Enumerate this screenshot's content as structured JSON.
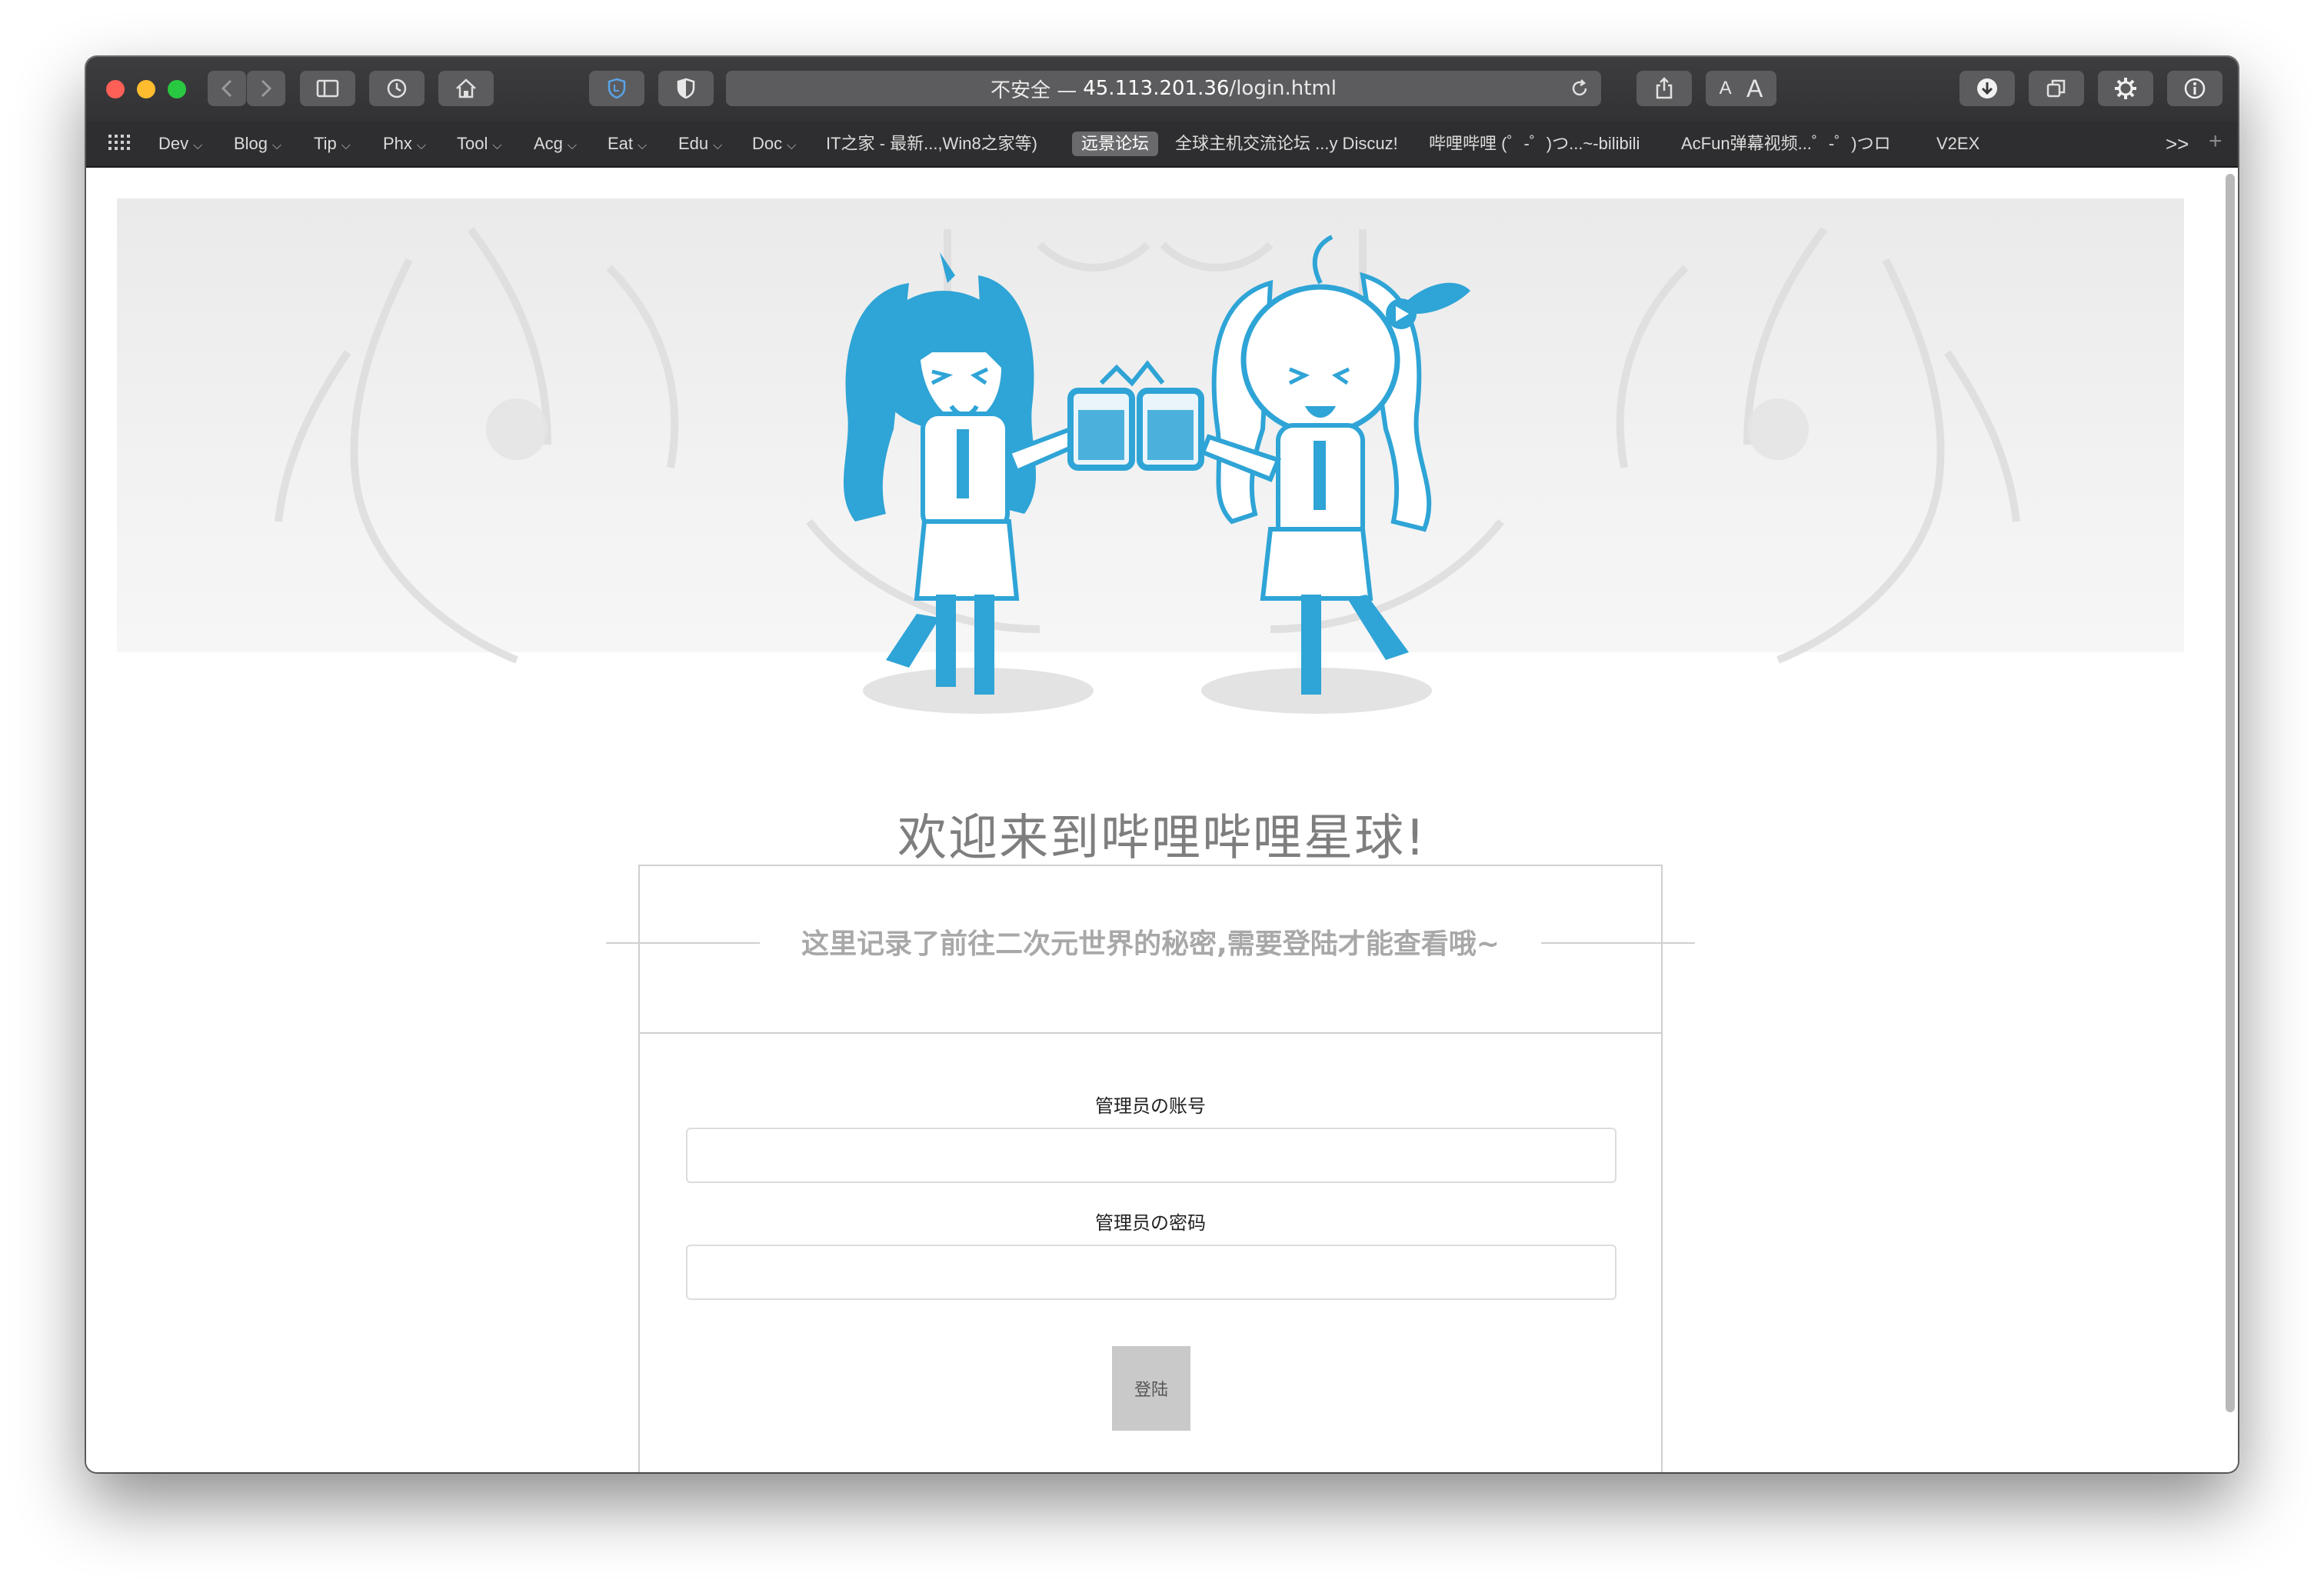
{
  "browser": {
    "address": {
      "security_label": "不安全 —",
      "host": "45.113.201.36",
      "path": "/login.html"
    },
    "toolbar_icons": [
      "back-icon",
      "forward-icon",
      "sidebar-icon",
      "history-icon",
      "home-icon",
      "shield-icon",
      "privacy-icon",
      "reload-icon",
      "share-icon",
      "font-small-icon",
      "font-large-icon",
      "download-icon",
      "tabs-icon",
      "settings-icon",
      "info-icon"
    ],
    "font_small": "A",
    "font_large": "A",
    "bookmarks": [
      {
        "label": "Dev",
        "menu": true
      },
      {
        "label": "Blog",
        "menu": true
      },
      {
        "label": "Tip",
        "menu": true
      },
      {
        "label": "Phx",
        "menu": true
      },
      {
        "label": "Tool",
        "menu": true
      },
      {
        "label": "Acg",
        "menu": true
      },
      {
        "label": "Eat",
        "menu": true
      },
      {
        "label": "Edu",
        "menu": true
      },
      {
        "label": "Doc",
        "menu": true
      },
      {
        "label": "IT之家 - 最新...,Win8之家等)",
        "menu": false
      },
      {
        "label": "远景论坛",
        "menu": false,
        "active": true
      },
      {
        "label": "全球主机交流论坛 ...y Discuz!",
        "menu": false
      },
      {
        "label": "哔哩哔哩 (゜-゜)つ...~-bilibili",
        "menu": false
      },
      {
        "label": "AcFun弹幕视频...゜-゜)つロ",
        "menu": false
      },
      {
        "label": "V2EX",
        "menu": false
      }
    ],
    "overflow_label": ">>",
    "new_tab_label": "+"
  },
  "page": {
    "welcome_title": "欢迎来到哔哩哔哩星球!",
    "subtitle": "这里记录了前往二次元世界的秘密,需要登陆才能查看哦~",
    "account_label": "管理员の账号",
    "password_label": "管理员の密码",
    "account_value": "",
    "password_value": "",
    "login_button": "登陆"
  },
  "colors": {
    "mascot_blue": "#2fa4d6",
    "toolbar": "#3a3a3c",
    "button_gray": "#c9c9c9"
  }
}
